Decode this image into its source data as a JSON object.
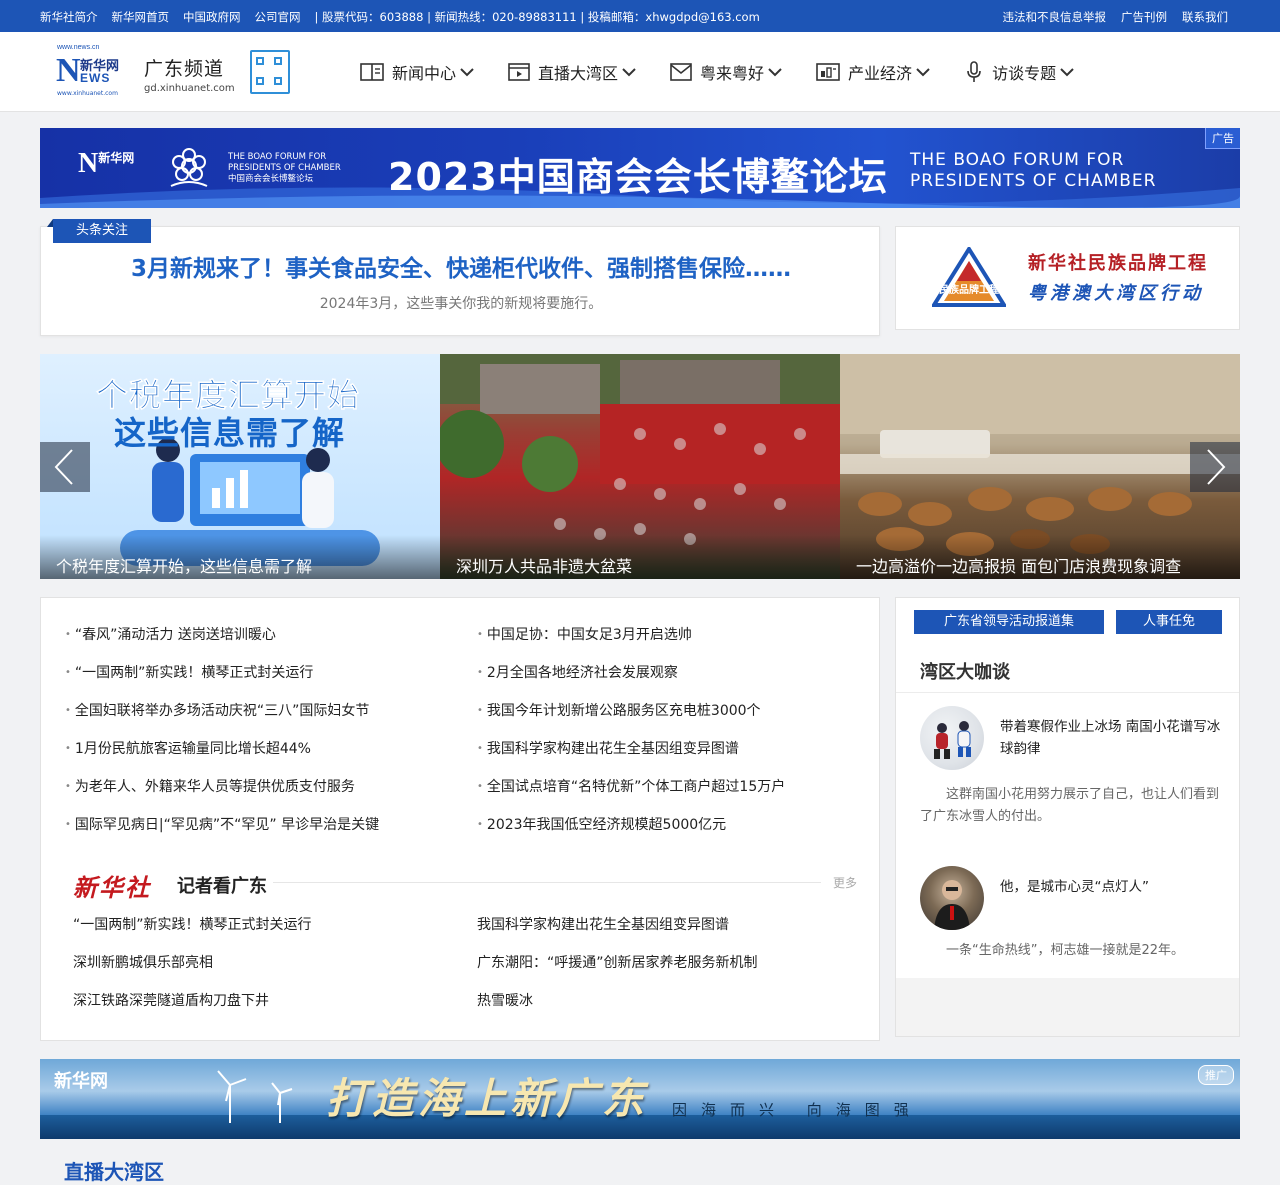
{
  "topbar": {
    "links": [
      "新华社简介",
      "新华网首页",
      "中国政府网",
      "公司官网"
    ],
    "stock": "| 股票代码：603888 | 新闻热线：020-89883111 | 投稿邮箱：xhwgdpd@163.com",
    "right_links": [
      "违法和不良信息举报",
      "广告刊例",
      "联系我们"
    ]
  },
  "header": {
    "logo_top": "www.news.cn",
    "logo_cn": "新华网",
    "logo_en": "EWS",
    "logo_bottom": "www.xinhuanet.com",
    "channel": "广东频道",
    "channel_url": "gd.xinhuanet.com",
    "nav": [
      {
        "label": "新闻中心",
        "icon": "book-icon"
      },
      {
        "label": "直播大湾区",
        "icon": "video-icon"
      },
      {
        "label": "粤来粤好",
        "icon": "mail-icon"
      },
      {
        "label": "产业经济",
        "icon": "chart-icon"
      },
      {
        "label": "访谈专题",
        "icon": "microphone-icon"
      }
    ]
  },
  "banner_top": {
    "ad_tag": "广告",
    "en_small": [
      "THE BOAO FORUM FOR",
      "PRESIDENTS OF CHAMBER",
      "中国商会会长博鳌论坛"
    ],
    "title": "2023中国商会会长博鳌论坛",
    "en_big": [
      "THE BOAO FORUM FOR",
      "PRESIDENTS OF CHAMBER"
    ]
  },
  "headline": {
    "tag": "头条关注",
    "title": "3月新规来了！事关食品安全、快递柜代收件、强制搭售保险……",
    "subtitle": "2024年3月，这些事关你我的新规将要施行。"
  },
  "brand": {
    "logo_text": "民族品牌工程",
    "line1": "新华社民族品牌工程",
    "line2": "粤港澳大湾区行动"
  },
  "carousel": {
    "slides": [
      {
        "headline1": "个税年度汇算开始",
        "headline2": "这些信息需了解",
        "caption": "个税年度汇算开始，这些信息需了解"
      },
      {
        "caption": "深圳万人共品非遗大盆菜"
      },
      {
        "caption": "一边高溢价一边高报损 面包门店浪费现象调查"
      }
    ]
  },
  "news": {
    "left": [
      "“春风”涌动活力 送岗送培训暖心",
      "“一国两制”新实践！横琴正式封关运行",
      "全国妇联将举办多场活动庆祝“三八”国际妇女节",
      "1月份民航旅客运输量同比增长超44%",
      "为老年人、外籍来华人员等提供优质支付服务",
      "国际罕见病日|“罕见病”不“罕见” 早诊早治是关键"
    ],
    "right": [
      "中国足协：中国女足3月开启选帅",
      "2月全国各地经济社会发展观察",
      "我国今年计划新增公路服务区充电桩3000个",
      "我国科学家构建出花生全基因组变异图谱",
      "全国试点培育“名特优新”个体工商户超过15万户",
      "2023年我国低空经济规模超5000亿元"
    ]
  },
  "reporter": {
    "logo": "新华社",
    "title": "记者看广东",
    "more": "更多",
    "left": [
      "“一国两制”新实践！横琴正式封关运行",
      "深圳新鹏城俱乐部亮相",
      "深江铁路深莞隧道盾构刀盘下井"
    ],
    "right": [
      "我国科学家构建出花生全基因组变异图谱",
      "广东潮阳：“呼援通”创新居家养老服务新机制",
      "热雪暖冰"
    ]
  },
  "side": {
    "btn1": "广东省领导活动报道集",
    "btn2": "人事任免",
    "title": "湾区大咖谈",
    "item1_title": "带着寒假作业上冰场 南国小花谱写冰球韵律",
    "item1_desc": "这群南国小花用努力展示了自己，也让人们看到了广东冰雪人的付出。",
    "item2_title": "他，是城市心灵“点灯人”",
    "item2_desc": "一条“生命热线”，柯志雄一接就是22年。"
  },
  "banner_bottom": {
    "tag": "推广",
    "title": "打造海上新广东",
    "subtitle": "因海而兴 向海图强"
  },
  "section_peek": "直播大湾区"
}
